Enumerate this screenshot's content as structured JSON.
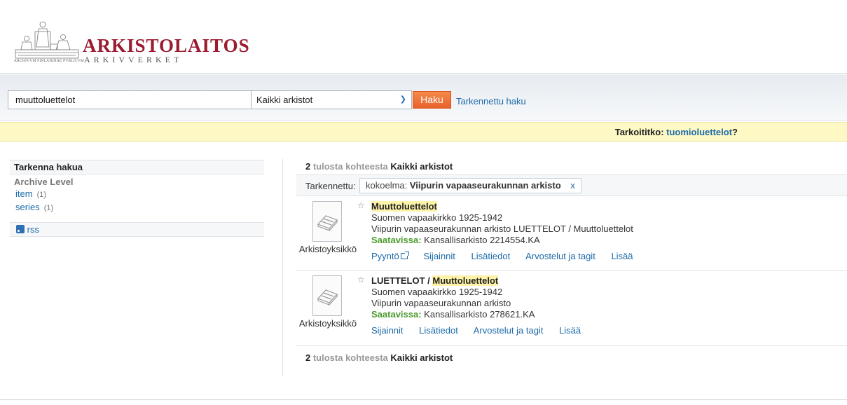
{
  "header": {
    "logo_title": "ARKISTOLAITOS",
    "logo_subtitle": "ARKIVVERKET",
    "logo_motto": "ARCHIVVM FINLANDIAE PVBLICVM"
  },
  "search": {
    "query": "muuttoluettelot",
    "scope_selected": "Kaikki arkistot",
    "submit_label": "Haku",
    "advanced_label": "Tarkennettu haku"
  },
  "did_you_mean": {
    "prefix": "Tarkoititko: ",
    "suggestion": "tuomioluettelot",
    "suffix": "?"
  },
  "sidebar": {
    "title": "Tarkenna hakua",
    "group_title": "Archive Level",
    "items": [
      {
        "label": "item",
        "count": "(1)"
      },
      {
        "label": "series",
        "count": "(1)"
      }
    ],
    "rss_label": "rss"
  },
  "results": {
    "count": "2",
    "count_mid": " tulosta kohteesta ",
    "scope": "Kaikki arkistot",
    "filter_label": "Tarkennettu:",
    "filter_key": "kokoelma:",
    "filter_value": "Viipurin vapaaseurakunnan arkisto",
    "filter_remove": "x",
    "records": [
      {
        "title_pre": "",
        "title_hl": "Muuttoluettelot",
        "line1": "Suomen vapaakirkko 1925-1942",
        "line2": "Viipurin vapaaseurakunnan arkisto LUETTELOT / Muuttoluettelot",
        "avail_label": "Saatavissa:",
        "avail_value": " Kansallisarkisto  2214554.KA",
        "type_label": "Arkistoyksikkö",
        "actions": [
          "Pyyntö",
          "Sijainnit",
          "Lisätiedot",
          "Arvostelut ja tagit",
          "Lisää"
        ]
      },
      {
        "title_pre": "LUETTELOT / ",
        "title_hl": "Muuttoluettelot",
        "line1": "Suomen vapaakirkko 1925-1942",
        "line2": "Viipurin vapaaseurakunnan arkisto",
        "avail_label": "Saatavissa:",
        "avail_value": " Kansallisarkisto  278621.KA",
        "type_label": "Arkistoyksikkö",
        "actions": [
          "Sijainnit",
          "Lisätiedot",
          "Arvostelut ja tagit",
          "Lisää"
        ]
      }
    ]
  },
  "colors": {
    "brand": "#9b1b30",
    "link": "#1d6aa9",
    "button": "#f07a3c",
    "available": "#4b9b2c",
    "notice_bg": "#fdf8c4"
  }
}
